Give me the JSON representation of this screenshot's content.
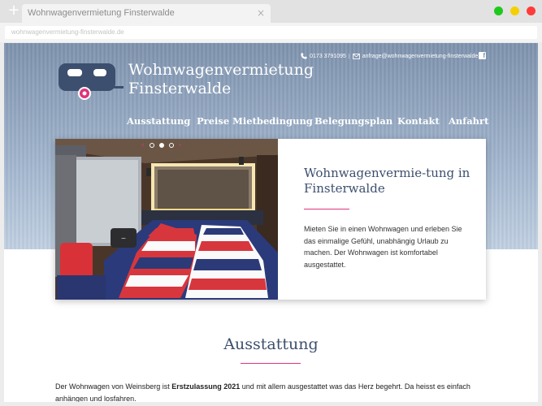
{
  "browser": {
    "new_tab_glyph": "+",
    "tab_title": "Wohnwagenvermietung Finsterwalde",
    "tab_close_glyph": "×",
    "url": "wohnwagenvermietung-finsterwalde.de",
    "window_controls": [
      {
        "name": "close",
        "color": "#ff3b3b"
      },
      {
        "name": "minimize",
        "color": "#f5d000"
      },
      {
        "name": "maximize",
        "color": "#1ec91e"
      }
    ]
  },
  "header": {
    "phone": "0173 3791095",
    "separator": "|",
    "email": "anfrage@wohnwagenvermietung-finsterwalde.de",
    "facebook_glyph": "f",
    "brand_line1": "Wohnwagenvermietung",
    "brand_line2": "Finsterwalde",
    "nav": [
      "Ausstattung",
      "Preise Mietbedingung",
      "Belegungsplan",
      "Kontakt",
      "Anfahrt"
    ]
  },
  "slider": {
    "prev_glyph": "‹",
    "next_glyph": "›",
    "dot_count": 3,
    "active_dot": 1,
    "title": "Wohnwagenvermie-tung in Finsterwalde",
    "body": "Mieten Sie in einen Wohnwagen und erleben Sie das einmalige Gefühl, unabhängig Urlaub zu machen. Der Wohnwagen ist komfortabel ausgestattet."
  },
  "section": {
    "title": "Ausstattung",
    "body_pre": "Der Wohnwagen von Weinsberg ist ",
    "body_bold": "Erstzulassung 2021",
    "body_post": " und mit allem ausgestattet was das Herz begehrt. Da heisst es einfach anhängen und losfahren."
  },
  "colors": {
    "accent": "#e0337a",
    "heading": "#3d4f6e",
    "hero_top": "#7e92ad",
    "hero_bottom": "#c0d0e2"
  }
}
